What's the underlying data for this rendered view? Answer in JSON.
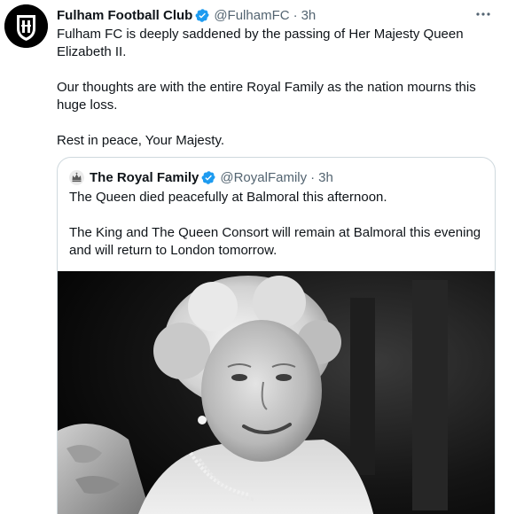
{
  "tweet": {
    "author": {
      "name": "Fulham Football Club",
      "handle": "@FulhamFC",
      "time": "3h",
      "avatar_icon": "fulham-crest-icon"
    },
    "verified_icon": "verified-badge-icon",
    "more_icon": "more-options-icon",
    "paragraphs": [
      "Fulham FC is deeply saddened by the passing of Her Majesty Queen Elizabeth II.",
      "Our thoughts are with the entire Royal Family as the nation mourns this huge loss.",
      "Rest in peace, Your Majesty."
    ]
  },
  "quoted_tweet": {
    "author": {
      "name": "The Royal Family",
      "handle": "@RoyalFamily",
      "time": "3h",
      "avatar_icon": "royal-crest-icon"
    },
    "paragraphs": [
      "The Queen died peacefully at Balmoral this afternoon.",
      "The King and The Queen Consort will remain at Balmoral this evening and will return to London tomorrow."
    ],
    "media": {
      "type": "photo",
      "style": "black-and-white portrait"
    }
  },
  "colors": {
    "text": "#0f1419",
    "secondary": "#536471",
    "verified": "#1d9bf0",
    "border": "#cfd9de"
  }
}
